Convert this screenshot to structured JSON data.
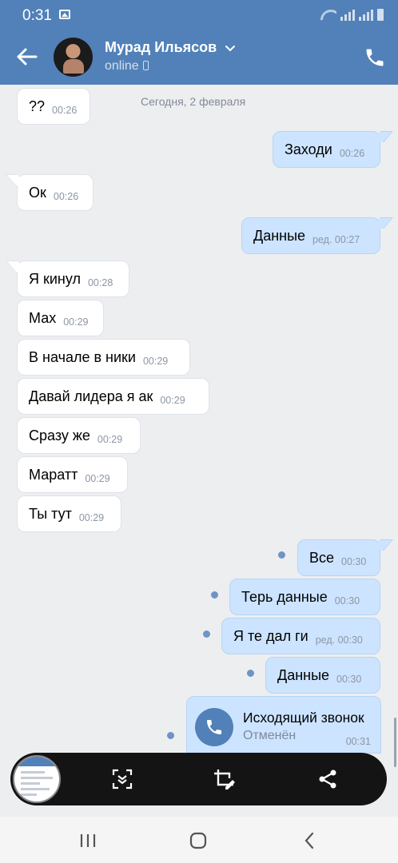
{
  "status_bar": {
    "time": "0:31"
  },
  "header": {
    "contact_name": "Мурад Ильясов",
    "status": "online",
    "bg_color": "#5181b8"
  },
  "date_separator": "Сегодня, 2 февраля",
  "messages": [
    {
      "text": "??",
      "time": "00:26",
      "dir": "in"
    },
    {
      "text": "Заходи",
      "time": "00:26",
      "dir": "out"
    },
    {
      "text": "Ок",
      "time": "00:26",
      "dir": "in"
    },
    {
      "text": "Данные",
      "time": "ред. 00:27",
      "dir": "out"
    },
    {
      "text": "Я кинул",
      "time": "00:28",
      "dir": "in"
    },
    {
      "text": "Мах",
      "time": "00:29",
      "dir": "in"
    },
    {
      "text": "В начале в ники",
      "time": "00:29",
      "dir": "in"
    },
    {
      "text": "Давай лидера я ак",
      "time": "00:29",
      "dir": "in"
    },
    {
      "text": "Сразу же",
      "time": "00:29",
      "dir": "in"
    },
    {
      "text": "Маратт",
      "time": "00:29",
      "dir": "in"
    },
    {
      "text": "Ты тут",
      "time": "00:29",
      "dir": "in"
    },
    {
      "text": "Все",
      "time": "00:30",
      "dir": "out",
      "unread": true
    },
    {
      "text": "Терь данные",
      "time": "00:30",
      "dir": "out",
      "unread": true
    },
    {
      "text": "Я те дал ги",
      "time": "ред. 00:30",
      "dir": "out",
      "unread": true
    },
    {
      "text": "Данные",
      "time": "00:30",
      "dir": "out",
      "unread": true
    }
  ],
  "call": {
    "title": "Исходящий звонок",
    "subtitle": "Отменён",
    "time": "00:31",
    "unread": true
  },
  "screenshot_toolbar": {
    "icons": [
      "screenshot-thumbnail",
      "scroll-capture-icon",
      "crop-edit-icon",
      "share-icon"
    ]
  },
  "navigation": {
    "icons": [
      "recent-apps-icon",
      "home-icon",
      "back-nav-icon"
    ]
  },
  "colors": {
    "accent": "#5181b8",
    "incoming_bubble": "#ffffff",
    "outgoing_bubble": "#cce4ff",
    "background": "#edeef0"
  }
}
